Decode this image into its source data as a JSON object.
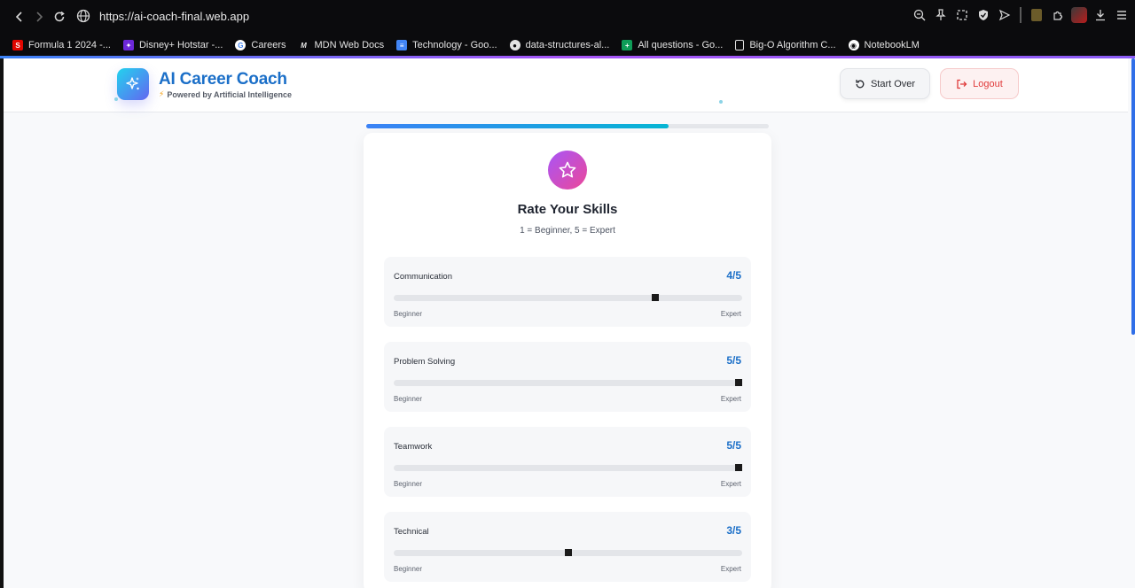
{
  "browser": {
    "url": "https://ai-coach-final.web.app",
    "bookmarks": [
      {
        "label": "Formula 1 2024 -...",
        "icon": "formula1-icon",
        "color": "#e10600",
        "glyph": "S"
      },
      {
        "label": "Disney+ Hotstar -...",
        "icon": "hotstar-icon",
        "color": "#6d28d9",
        "glyph": "✦"
      },
      {
        "label": "Careers",
        "icon": "google-icon",
        "color": "#ffffff",
        "glyph": "G"
      },
      {
        "label": "MDN Web Docs",
        "icon": "mdn-icon",
        "color": "#0b0b0d",
        "glyph": "M"
      },
      {
        "label": "Technology - Goo...",
        "icon": "google-docs-icon",
        "color": "#4285f4",
        "glyph": "≡"
      },
      {
        "label": "data-structures-al...",
        "icon": "github-icon",
        "color": "#0b0b0d",
        "glyph": "●"
      },
      {
        "label": "All questions - Go...",
        "icon": "google-sheets-icon",
        "color": "#0f9d58",
        "glyph": "+"
      },
      {
        "label": "Big-O Algorithm C...",
        "icon": "page-icon",
        "color": "#0b0b0d",
        "glyph": "▯"
      },
      {
        "label": "NotebookLM",
        "icon": "notebooklm-icon",
        "color": "#ffffff",
        "glyph": "◉"
      }
    ]
  },
  "header": {
    "title": "AI Career Coach",
    "subtitle": "Powered by Artificial Intelligence",
    "start_over_label": "Start Over",
    "logout_label": "Logout"
  },
  "progress": {
    "fraction": 0.75
  },
  "card": {
    "title": "Rate Your Skills",
    "subtitle": "1 = Beginner, 5 = Expert",
    "min_label": "Beginner",
    "max_label": "Expert",
    "skills": [
      {
        "name": "Communication",
        "score": "4/5",
        "value": 4
      },
      {
        "name": "Problem Solving",
        "score": "5/5",
        "value": 5
      },
      {
        "name": "Teamwork",
        "score": "5/5",
        "value": 5
      },
      {
        "name": "Technical",
        "score": "3/5",
        "value": 3
      }
    ]
  },
  "colors": {
    "brand": "#1b6fc8",
    "accent_gradient_start": "#3b82f6",
    "accent_gradient_end": "#06b6d4",
    "logout": "#e03a3a"
  }
}
